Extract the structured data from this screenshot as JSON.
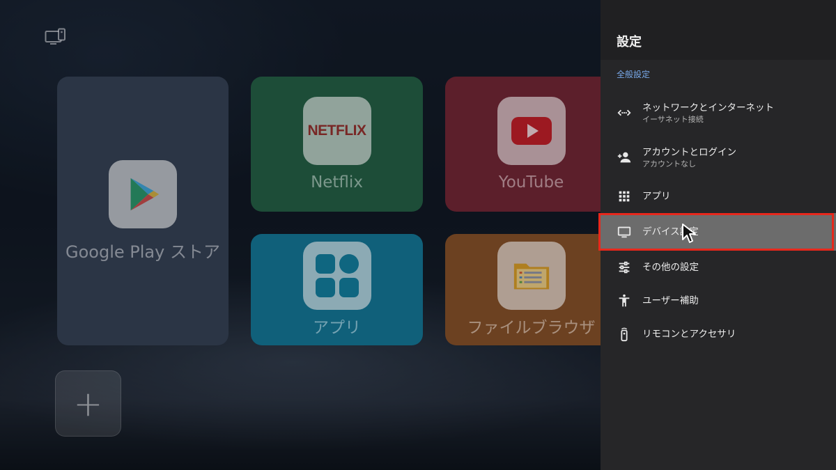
{
  "launcher": {
    "apps": {
      "google_play": "Google Play ストア",
      "netflix": "Netflix",
      "netflix_logo_text": "NETFLIX",
      "youtube": "YouTube",
      "apps": "アプリ",
      "file_browser": "ファイルブラウザ"
    },
    "add_label": "+"
  },
  "settings": {
    "title": "設定",
    "section": "全般設定",
    "items": [
      {
        "label": "ネットワークとインターネット",
        "sub": "イーサネット接続",
        "icon": "network-icon"
      },
      {
        "label": "アカウントとログイン",
        "sub": "アカウントなし",
        "icon": "add-person-icon"
      },
      {
        "label": "アプリ",
        "icon": "apps-grid-icon"
      },
      {
        "label": "デバイス設定",
        "icon": "tv-icon",
        "selected": true
      },
      {
        "label": "その他の設定",
        "icon": "sliders-icon"
      },
      {
        "label": "ユーザー補助",
        "icon": "accessibility-icon"
      },
      {
        "label": "リモコンとアクセサリ",
        "icon": "remote-icon"
      }
    ]
  },
  "colors": {
    "panel": "#262628",
    "section_label": "#78a8e8",
    "selected_row": "#6c6c6c",
    "highlight_box": "#e8281c"
  }
}
